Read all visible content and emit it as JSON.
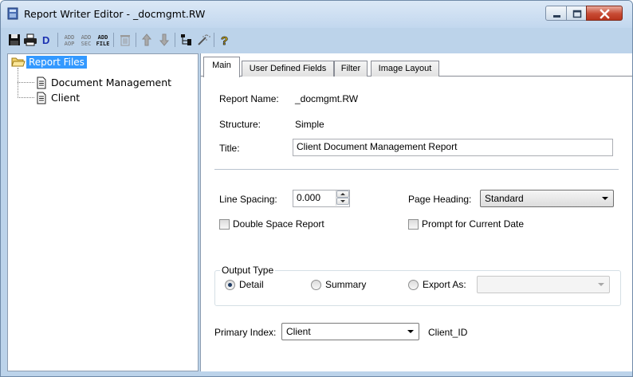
{
  "window": {
    "title": "Report Writer Editor - _docmgmt.RW"
  },
  "toolbar": {
    "icons": [
      "save-icon",
      "print-icon",
      "d-icon",
      "add-aop-icon",
      "add-sec-icon",
      "add-file-icon",
      "delete-icon",
      "move-up-icon",
      "move-down-icon",
      "structure-icon",
      "wizard-icon",
      "help-icon"
    ],
    "d_label": "D",
    "add_aop_top": "ADD",
    "add_aop_bottom": "AOP",
    "add_sec_top": "ADD",
    "add_sec_bottom": "SEC",
    "add_file_top": "ADD",
    "add_file_bottom": "FILE",
    "help_label": "?"
  },
  "tree": {
    "root": "Report Files",
    "items": [
      {
        "label": "Document Management"
      },
      {
        "label": "Client"
      }
    ]
  },
  "tabs": [
    {
      "label": "Main",
      "active": true
    },
    {
      "label": "User Defined Fields",
      "active": false
    },
    {
      "label": "Filter",
      "active": false
    },
    {
      "label": "Image Layout",
      "active": false
    }
  ],
  "main": {
    "report_name_label": "Report Name:",
    "report_name_value": "_docmgmt.RW",
    "structure_label": "Structure:",
    "structure_value": "Simple",
    "title_label": "Title:",
    "title_value": "Client Document Management Report",
    "line_spacing_label": "Line Spacing:",
    "line_spacing_value": "0.000",
    "page_heading_label": "Page Heading:",
    "page_heading_value": "Standard",
    "double_space_label": "Double Space Report",
    "double_space_checked": false,
    "prompt_date_label": "Prompt for Current Date",
    "prompt_date_checked": false,
    "output_type": {
      "legend": "Output Type",
      "options": [
        {
          "label": "Detail",
          "checked": true
        },
        {
          "label": "Summary",
          "checked": false
        },
        {
          "label": "Export As:",
          "checked": false
        }
      ],
      "export_value": ""
    },
    "primary_index_label": "Primary Index:",
    "primary_index_value": "Client",
    "primary_index_key": "Client_ID"
  },
  "colors": {
    "selection": "#3399ff",
    "title_bar": "#c2d7ee",
    "close_button": "#c74a33"
  }
}
